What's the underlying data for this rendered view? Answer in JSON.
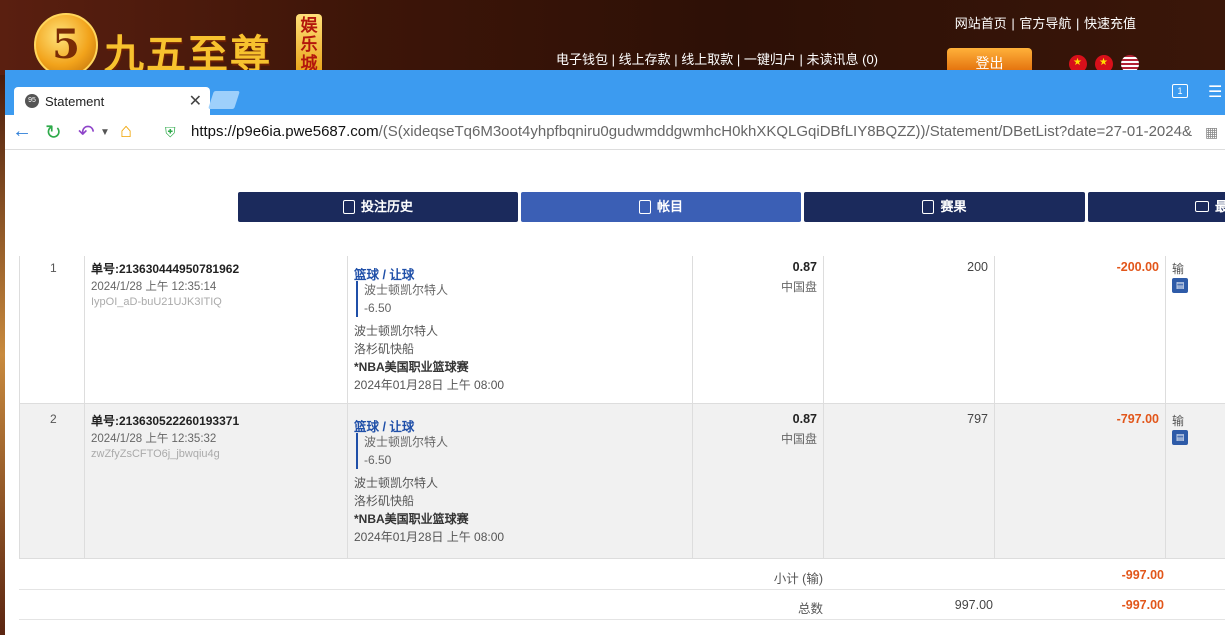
{
  "site": {
    "logo_digit": "5",
    "logo_text": "九五至尊",
    "logo_badge": "娱乐城",
    "top_links": [
      "网站首页",
      "官方导航",
      "快速充值"
    ],
    "nav_links": [
      "电子钱包",
      "线上存款",
      "线上取款",
      "一键归户",
      "未读讯息 (0)"
    ],
    "logout_label": "登出",
    "flags": [
      "hk-flag-icon",
      "cn-flag-icon",
      "us-flag-icon"
    ]
  },
  "browser": {
    "tab_title": "Statement",
    "tab_close": "✕",
    "url_domain": "https://p9e6ia.pwe5687.com",
    "url_path": "/(S(xideqseTq6M3oot4yhpfbqniru0gudwmddgwmhcH0khXKQLGqiDBfLIY8BQZZ))/Statement/DBetList?date=27-01-2024&",
    "window_count": "1",
    "accent_color": "#3c9bf0"
  },
  "page_tabs": [
    {
      "label": "投注历史",
      "icon": "history-icon"
    },
    {
      "label": "帐目",
      "icon": "ledger-icon"
    },
    {
      "label": "赛果",
      "icon": "results-icon"
    },
    {
      "label": "最",
      "icon": "mail-icon"
    }
  ],
  "bets": [
    {
      "index": "1",
      "order_no": "单号:213630444950781962",
      "time": "2024/1/28 上午 12:35:14",
      "code": "IypOI_aD-buU21UJK3ITIQ",
      "bet_type": "篮球 / 让球",
      "pick_team": "波士顿凯尔特人",
      "pick_handicap": "-6.50",
      "home_team": "波士顿凯尔特人",
      "away_team": "洛杉矶快船",
      "league": "*NBA美国职业篮球赛",
      "match_date": "2024年01月28日 上午 08:00",
      "odds": "0.87",
      "odds_type": "中国盘",
      "stake": "200",
      "win_loss": "-200.00",
      "status": "输"
    },
    {
      "index": "2",
      "order_no": "单号:213630522260193371",
      "time": "2024/1/28 上午 12:35:32",
      "code": "zwZfyZsCFTO6j_jbwqiu4g",
      "bet_type": "篮球 / 让球",
      "pick_team": "波士顿凯尔特人",
      "pick_handicap": "-6.50",
      "home_team": "波士顿凯尔特人",
      "away_team": "洛杉矶快船",
      "league": "*NBA美国职业篮球赛",
      "match_date": "2024年01月28日 上午 08:00",
      "odds": "0.87",
      "odds_type": "中国盘",
      "stake": "797",
      "win_loss": "-797.00",
      "status": "输"
    }
  ],
  "summary": {
    "subtotal_label": "小计 (输)",
    "subtotal_win": "-997.00",
    "total_label": "总数",
    "total_stake": "997.00",
    "total_win": "-997.00"
  }
}
